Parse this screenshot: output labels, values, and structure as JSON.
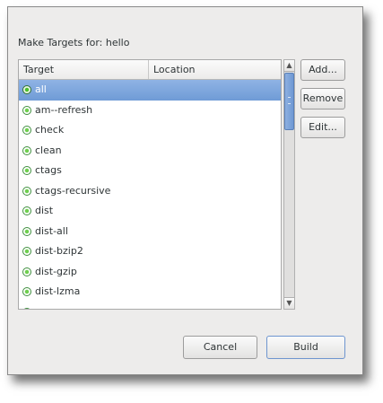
{
  "dialog": {
    "caption": "Make Targets for: hello"
  },
  "list": {
    "columns": {
      "target": "Target",
      "location": "Location"
    },
    "selected_index": 0,
    "rows": [
      {
        "target": "all"
      },
      {
        "target": "am--refresh"
      },
      {
        "target": "check"
      },
      {
        "target": "clean"
      },
      {
        "target": "ctags"
      },
      {
        "target": "ctags-recursive"
      },
      {
        "target": "dist"
      },
      {
        "target": "dist-all"
      },
      {
        "target": "dist-bzip2"
      },
      {
        "target": "dist-gzip"
      },
      {
        "target": "dist-lzma"
      },
      {
        "target": ""
      }
    ]
  },
  "side_buttons": {
    "add": "Add...",
    "remove": "Remove",
    "edit": "Edit..."
  },
  "footer": {
    "cancel": "Cancel",
    "build": "Build"
  },
  "icons": {
    "scroll_up": "scroll-up-arrow-icon",
    "scroll_down": "scroll-down-arrow-icon",
    "row_icon": "make-target-icon"
  },
  "colors": {
    "selection": "#7ba3dc",
    "dialog_bg": "#edeceb",
    "target_icon": "#4cbf2c"
  }
}
